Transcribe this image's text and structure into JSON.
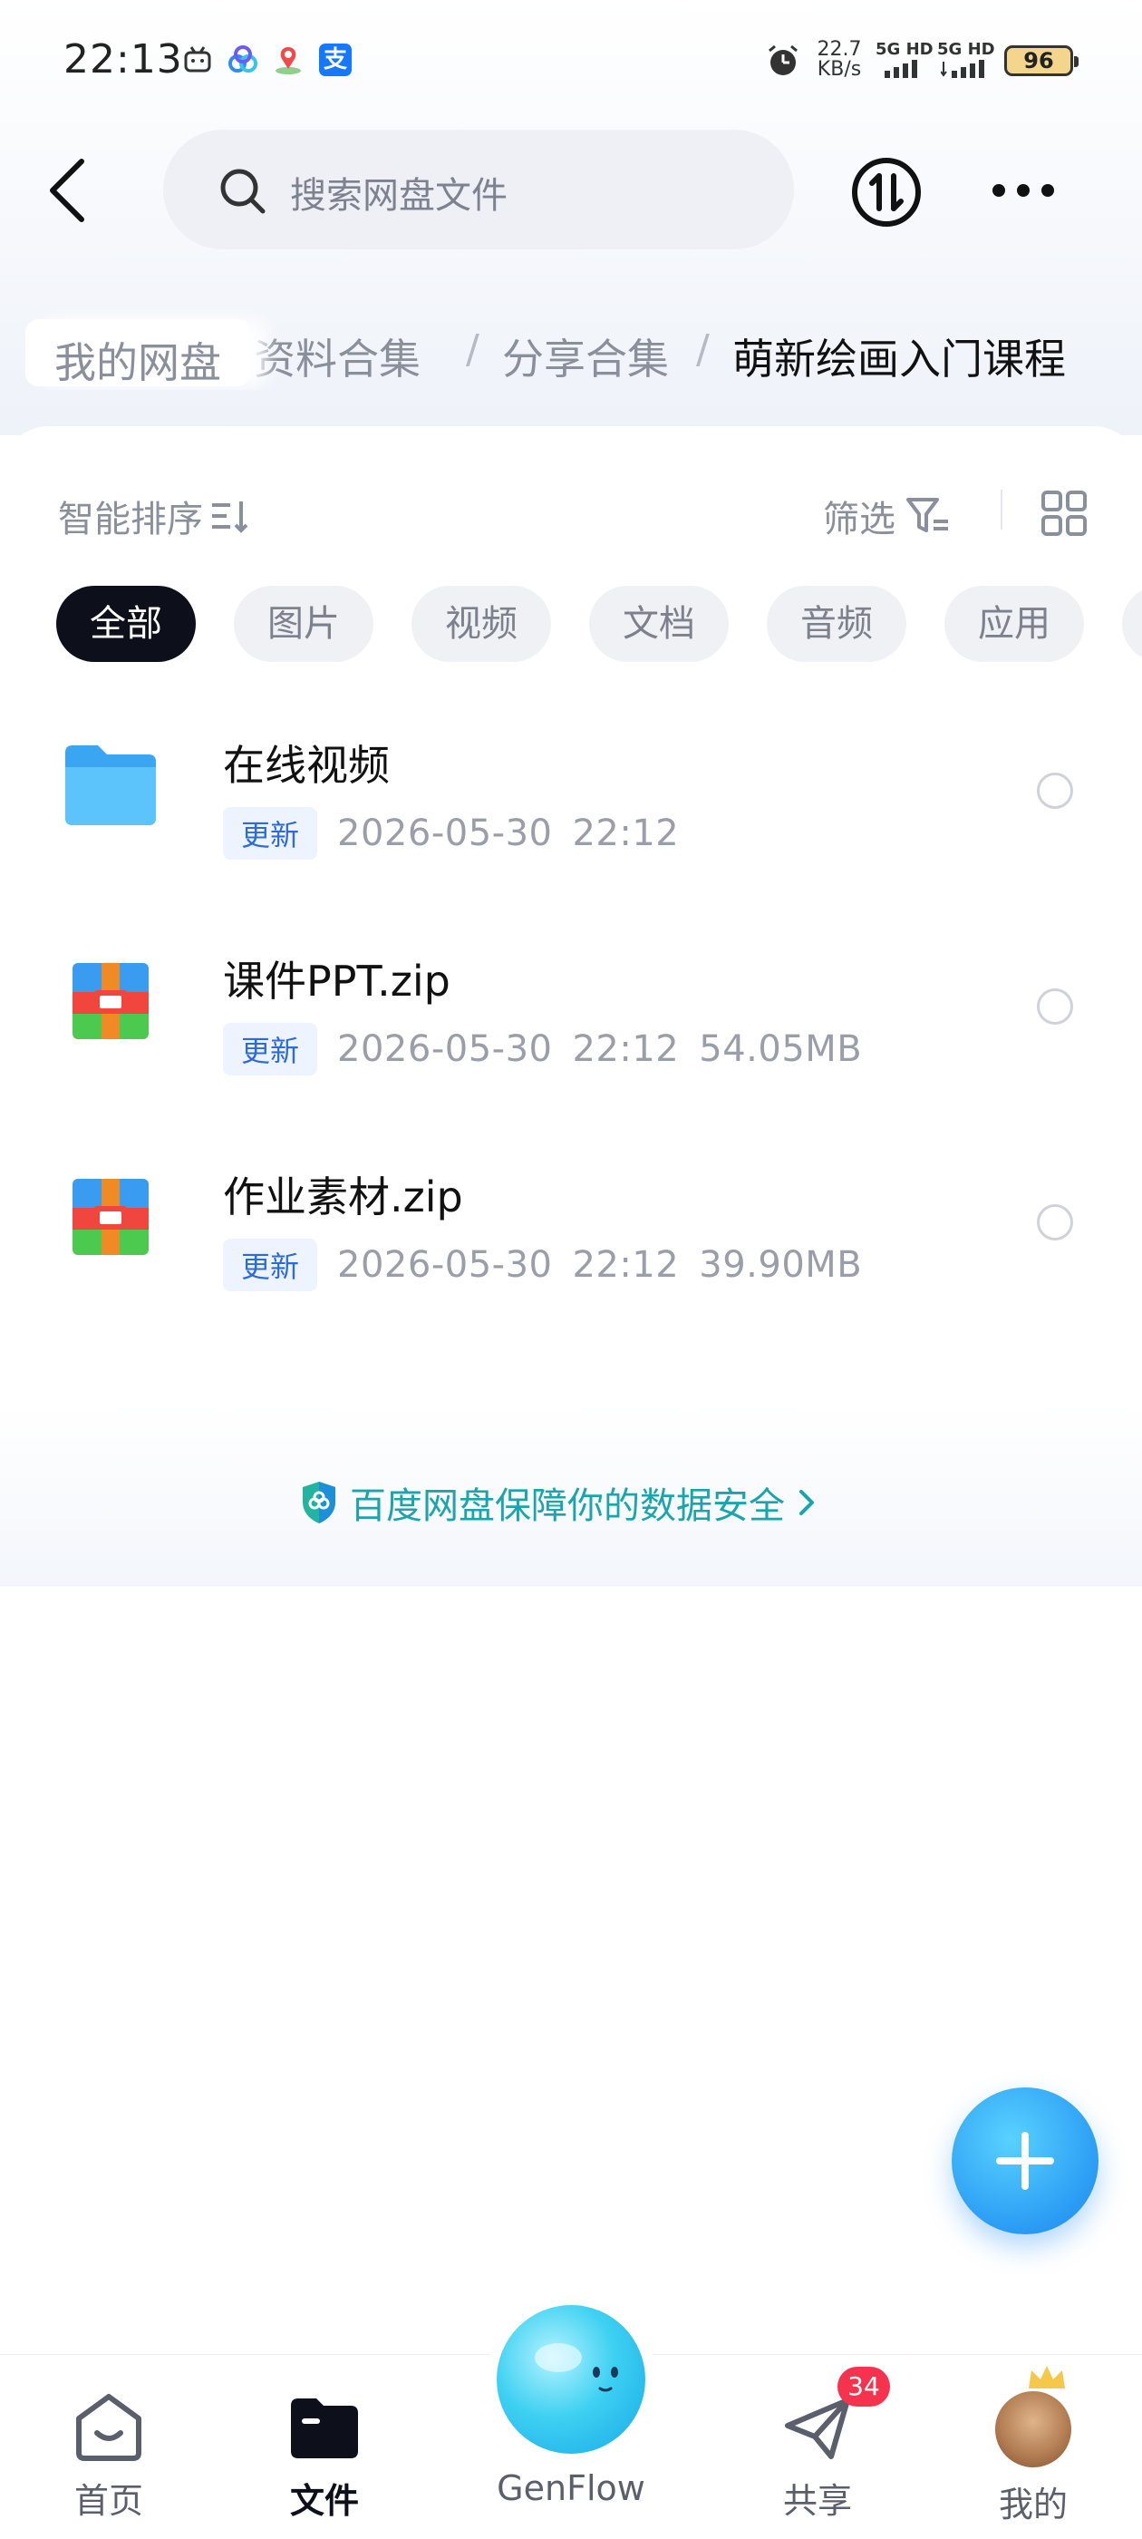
{
  "status_bar": {
    "time": "22:13",
    "net_speed_value": "22.7",
    "net_speed_unit": "KB/s",
    "sim1_label": "5G HD",
    "sim2_label": "5G HD",
    "battery": "96",
    "alipay_glyph": "支",
    "icons": [
      "bilibili-icon",
      "baidu-cloud-icon",
      "map-icon",
      "alipay-icon",
      "alarm-icon"
    ]
  },
  "header": {
    "search_placeholder": "搜索网盘文件"
  },
  "breadcrumb": {
    "items": [
      "我的网盘",
      "资料合集",
      "分享合集",
      "萌新绘画入门课程"
    ],
    "separator": "/"
  },
  "toolbar": {
    "sort_label": "智能排序",
    "filter_label": "筛选"
  },
  "chips": {
    "items": [
      "全部",
      "图片",
      "视频",
      "文档",
      "音频",
      "应用"
    ],
    "active_index": 0
  },
  "files": [
    {
      "name": "在线视频",
      "type": "folder",
      "badge": "更新",
      "date": "2026-05-30",
      "time": "22:12",
      "size": ""
    },
    {
      "name": "课件PPT.zip",
      "type": "zip",
      "badge": "更新",
      "date": "2026-05-30",
      "time": "22:12",
      "size": "54.05MB"
    },
    {
      "name": "作业素材.zip",
      "type": "zip",
      "badge": "更新",
      "date": "2026-05-30",
      "time": "22:12",
      "size": "39.90MB"
    }
  ],
  "security": {
    "text": "百度网盘保障你的数据安全"
  },
  "bottom_nav": {
    "items": [
      {
        "label": "首页",
        "icon": "home-icon"
      },
      {
        "label": "文件",
        "icon": "folder-icon",
        "active": true
      },
      {
        "label": "GenFlow",
        "icon": "genflow-icon"
      },
      {
        "label": "共享",
        "icon": "share-icon",
        "badge": "34"
      },
      {
        "label": "我的",
        "icon": "avatar"
      }
    ]
  },
  "colors": {
    "accent": "#1e86ea",
    "security_text": "#1aa5ad",
    "badge_red": "#f5334e",
    "chip_active": "#0d0f1a"
  }
}
